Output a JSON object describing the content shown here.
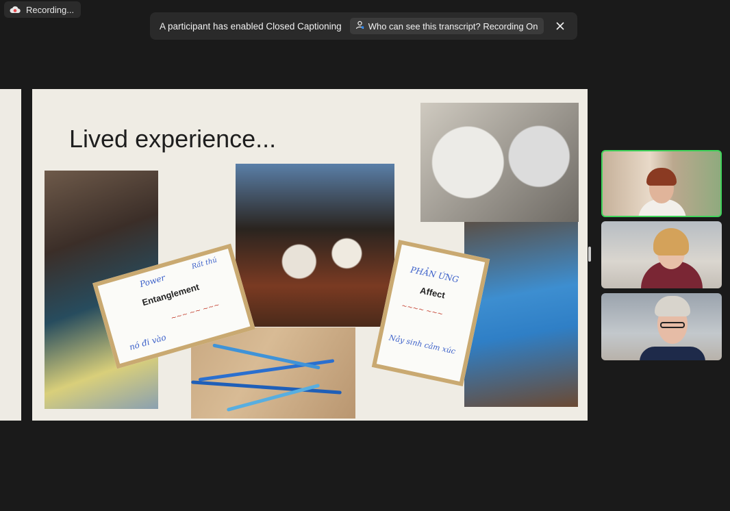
{
  "recording": {
    "label": "Recording..."
  },
  "banner": {
    "message": "A participant has enabled Closed Captioning",
    "who_button": "Who can see this transcript? Recording On"
  },
  "slide": {
    "title": "Lived experience...",
    "paper1_label": "Entanglement",
    "paper1_words": [
      "Power",
      "Rất thú",
      "nó đi vào"
    ],
    "paper2_label": "Affect",
    "paper2_words": [
      "PHẢN ỨNG",
      "Nảy sinh cảm xúc"
    ]
  },
  "colors": {
    "active_speaker": "#3fd45a",
    "banner_bg": "#2a2a2a",
    "background": "#1a1a1a"
  },
  "icons": [
    "recording-cloud-icon",
    "person-icon",
    "close-icon"
  ]
}
